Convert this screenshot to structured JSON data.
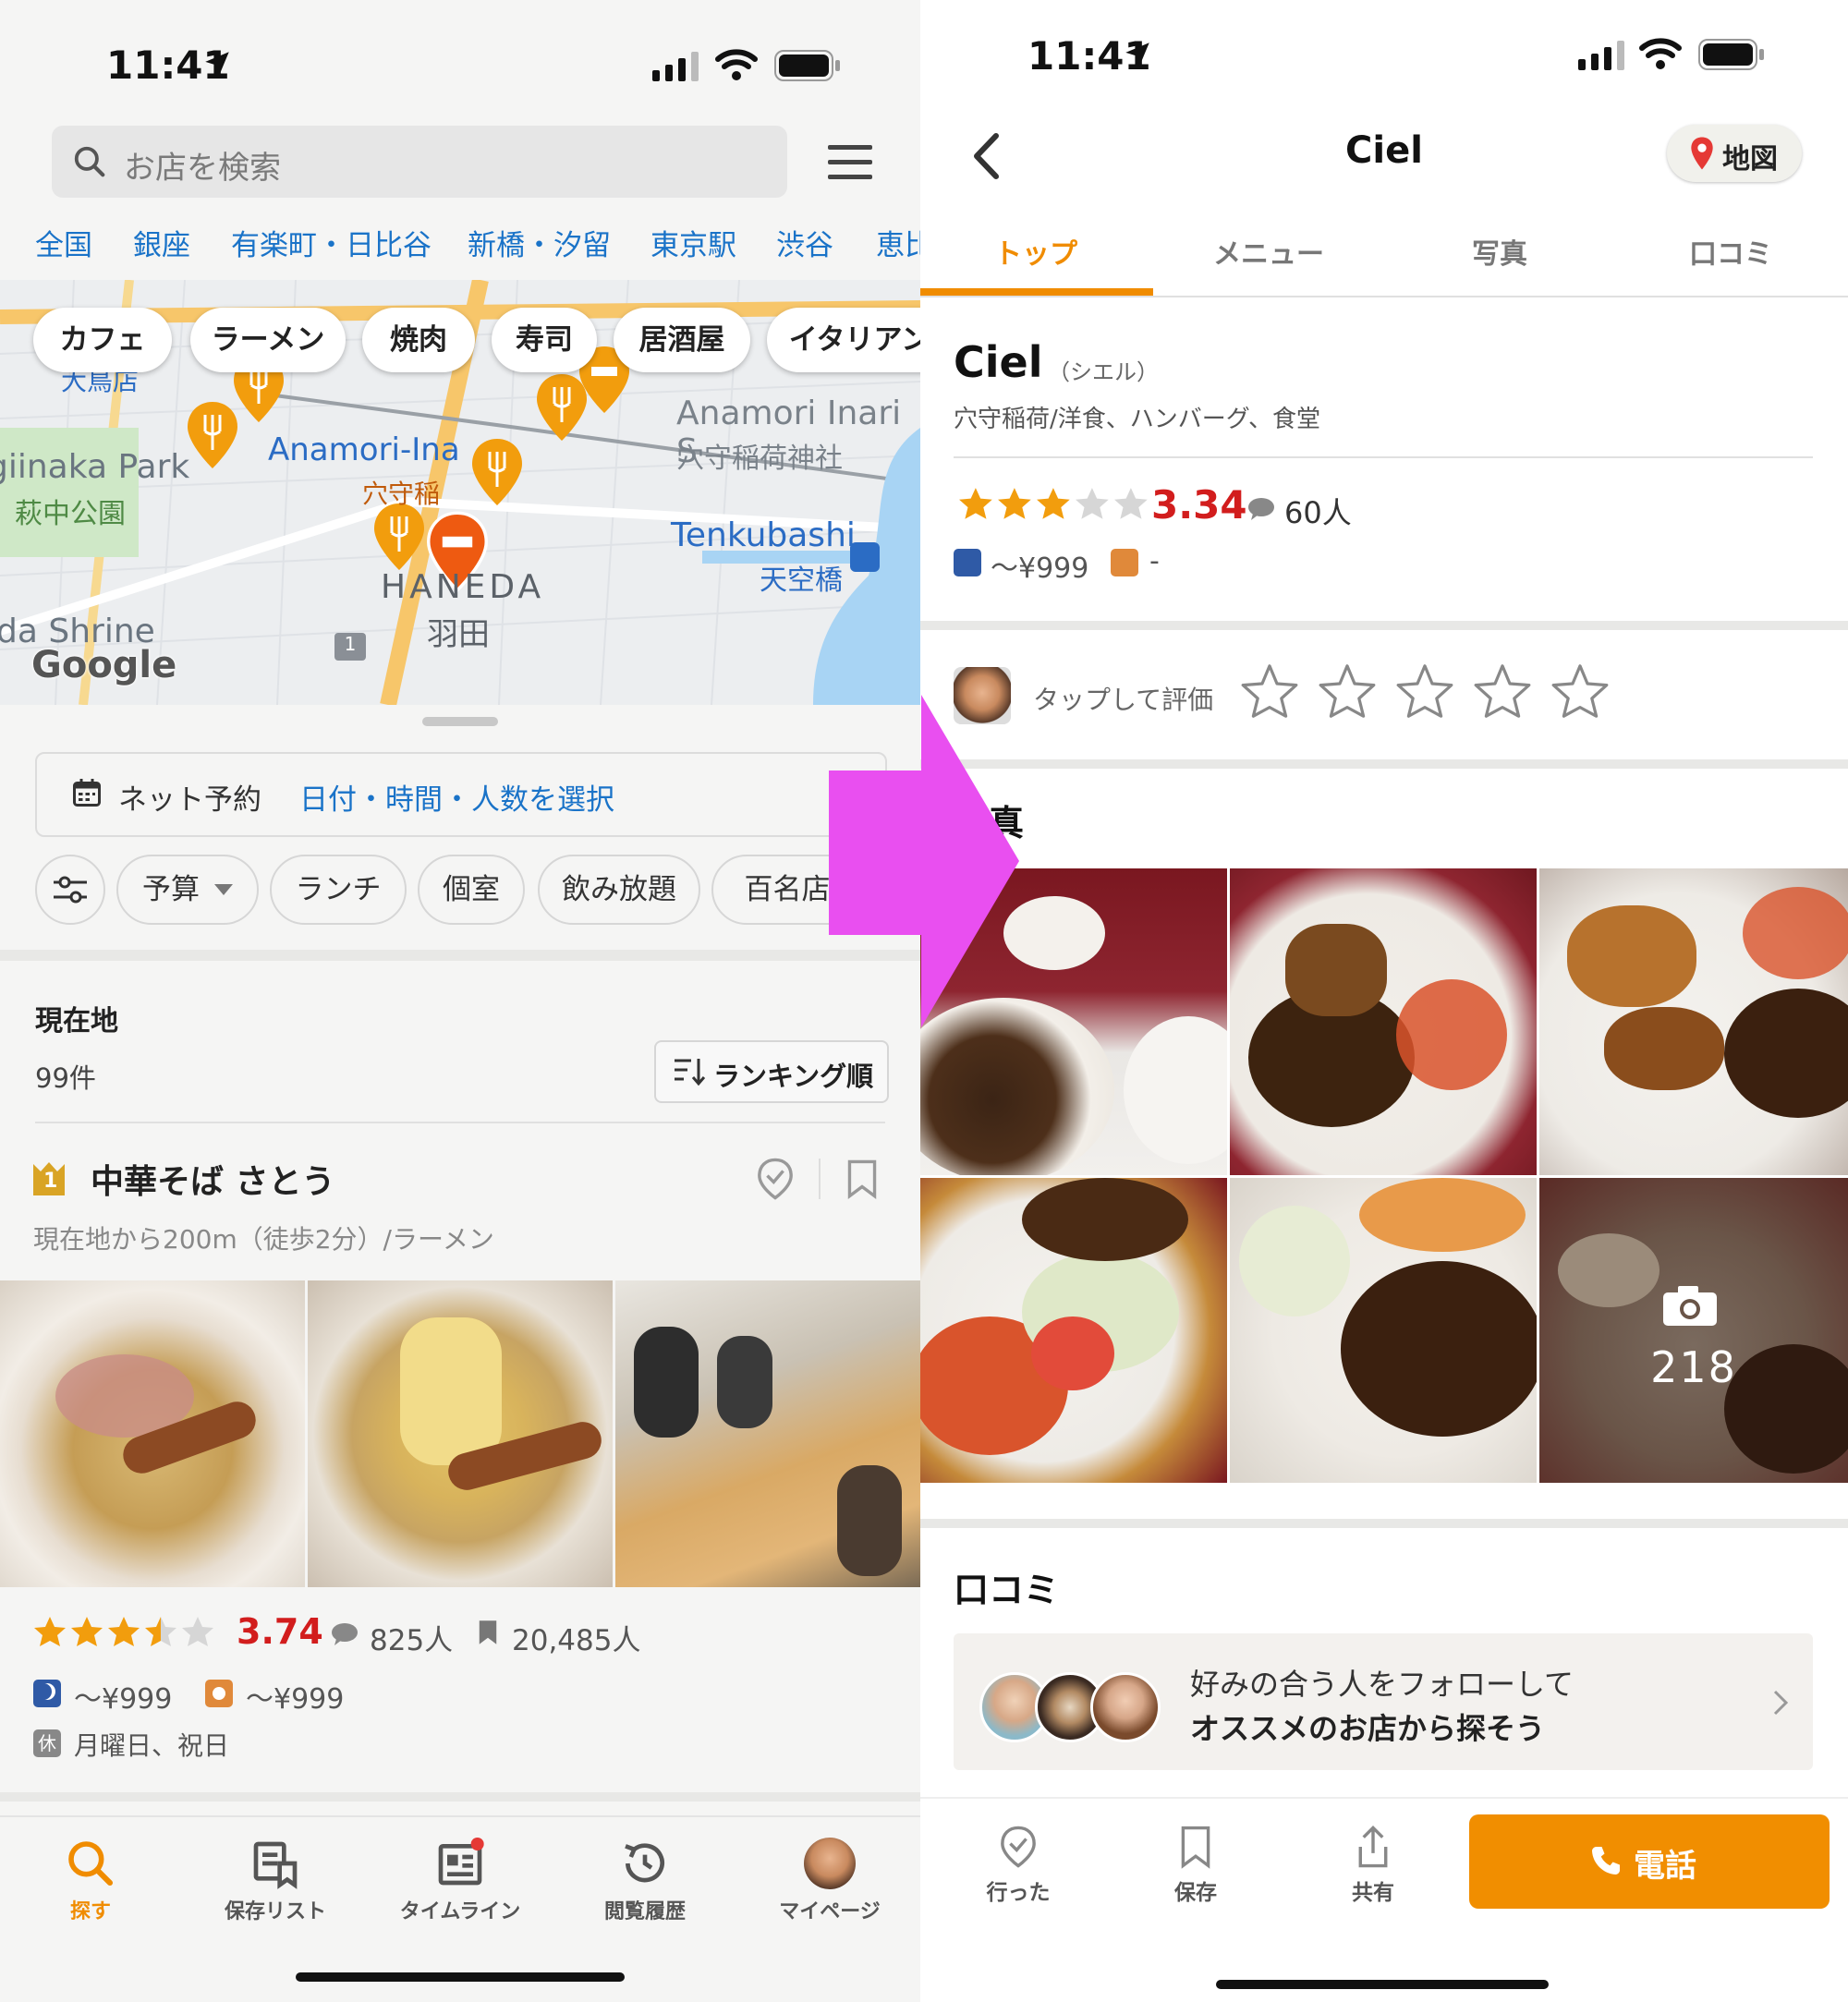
{
  "left": {
    "status": {
      "time": "11:41"
    },
    "search": {
      "placeholder": "お店を検索"
    },
    "areas": [
      "全国",
      "銀座",
      "有楽町・日比谷",
      "新橋・汐留",
      "東京駅",
      "渋谷",
      "恵比"
    ],
    "map": {
      "categories": [
        "カフェ",
        "ラーメン",
        "焼肉",
        "寿司",
        "居酒屋",
        "イタリアン"
      ],
      "labels": {
        "park": "giinaka Park",
        "park_jp": "萩中公園",
        "anamori": "Anamori-Ina",
        "anamori_jp": "穴守稲",
        "inari_en": "Anamori Inari S",
        "inari_jp": "穴守稲荷神社",
        "haneda_en": "HANEDA",
        "haneda_jp": "羽田",
        "tenkubashi_en": "Tenkubashi",
        "tenkubashi_jp": "天空橋",
        "shrine": "da Shrine",
        "otori": "大鳥店",
        "brand": "Google",
        "route1": "1"
      }
    },
    "reserve": {
      "label": "ネット予約",
      "action": "日付・時間・人数を選択"
    },
    "filters": [
      "予算",
      "ランチ",
      "個室",
      "飲み放題",
      "百名店"
    ],
    "location": {
      "title": "現在地",
      "count": "99件",
      "sort": "ランキング順"
    },
    "shop": {
      "rank": "1",
      "name": "中華そば さとう",
      "sub": "現在地から200m（徒歩2分）/ラーメン",
      "rating": "3.74",
      "reviews": "825人",
      "saves": "20,485人",
      "dinner": "～¥999",
      "lunch": "～¥999",
      "closed_badge": "休",
      "closed": "月曜日、祝日"
    },
    "tabs": [
      "探す",
      "保存リスト",
      "タイムライン",
      "閲覧履歴",
      "マイページ"
    ]
  },
  "right": {
    "status": {
      "time": "11:41"
    },
    "title": "Ciel",
    "map_button": "地図",
    "tabs": [
      "トップ",
      "メニュー",
      "写真",
      "口コミ"
    ],
    "shop": {
      "name": "Ciel",
      "kana": "（シエル）",
      "genre": "穴守稲荷/洋食、ハンバーグ、食堂",
      "rating": "3.34",
      "reviews": "60人",
      "dinner": "～¥999",
      "lunch": "-"
    },
    "rate_prompt": "タップして評価",
    "photos_title": "写真",
    "photos_count": "218",
    "reviews_title": "口コミ",
    "follow": {
      "line1": "好みの合う人をフォローして",
      "line2": "オススメのお店から探そう"
    },
    "actions": [
      "行った",
      "保存",
      "共有"
    ],
    "call": "電話"
  },
  "colors": {
    "accent": "#f08c00",
    "rating_red": "#d21d1d",
    "link_blue": "#1a73c8",
    "arrow_magenta": "#e94ff0"
  }
}
